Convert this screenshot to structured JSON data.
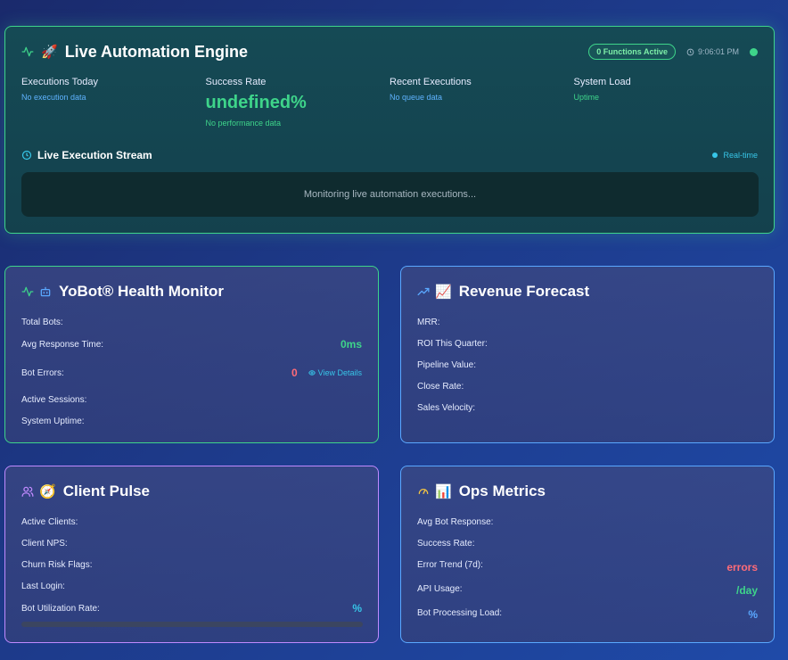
{
  "engine": {
    "title": "Live Automation Engine",
    "badge": "0 Functions Active",
    "time": "9:06:01 PM",
    "stats": [
      {
        "label": "Executions Today",
        "sub": "No execution data"
      },
      {
        "label": "Success Rate",
        "value": "undefined%",
        "sub": "No performance data"
      },
      {
        "label": "Recent Executions",
        "sub": "No queue data"
      },
      {
        "label": "System Load",
        "sub": "Uptime"
      }
    ],
    "stream_title": "Live Execution Stream",
    "realtime": "Real-time",
    "stream_message": "Monitoring live automation executions..."
  },
  "health": {
    "title": "YoBot® Health Monitor",
    "rows": [
      {
        "label": "Total Bots:",
        "value": ""
      },
      {
        "label": "Avg Response Time:",
        "value": "0ms"
      },
      {
        "label": "Bot Errors:",
        "value": "0",
        "link": "View Details"
      },
      {
        "label": "Active Sessions:",
        "value": ""
      },
      {
        "label": "System Uptime:",
        "value": ""
      }
    ]
  },
  "revenue": {
    "title": "Revenue Forecast",
    "rows": [
      {
        "label": "MRR:"
      },
      {
        "label": "ROI This Quarter:"
      },
      {
        "label": "Pipeline Value:"
      },
      {
        "label": "Close Rate:"
      },
      {
        "label": "Sales Velocity:"
      }
    ]
  },
  "client": {
    "title": "Client Pulse",
    "rows": [
      {
        "label": "Active Clients:"
      },
      {
        "label": "Client NPS:"
      },
      {
        "label": "Churn Risk Flags:"
      },
      {
        "label": "Last Login:"
      },
      {
        "label": "Bot Utilization Rate:",
        "value": "%"
      }
    ],
    "utilization_progress": 0
  },
  "ops": {
    "title": "Ops Metrics",
    "rows": [
      {
        "label": "Avg Bot Response:"
      },
      {
        "label": "Success Rate:"
      },
      {
        "label": "Error Trend (7d):",
        "value": "errors"
      },
      {
        "label": "API Usage:",
        "value": "/day"
      },
      {
        "label": "Bot Processing Load:",
        "value": "%"
      }
    ]
  },
  "icons": {
    "engine": "activity-icon",
    "rocket": "rocket-emoji",
    "health": "activity-icon",
    "bot": "bot-icon",
    "revenue": "trending-up-icon",
    "chart": "chart-emoji",
    "client": "users-icon",
    "compass": "compass-emoji",
    "ops": "gauge-icon",
    "bar": "bar-chart-emoji"
  },
  "colors": {
    "green": "#3ed48a",
    "blue": "#5aa8ff",
    "purple": "#c08aff",
    "red": "#ff6b78",
    "cyan": "#37c6e8"
  }
}
